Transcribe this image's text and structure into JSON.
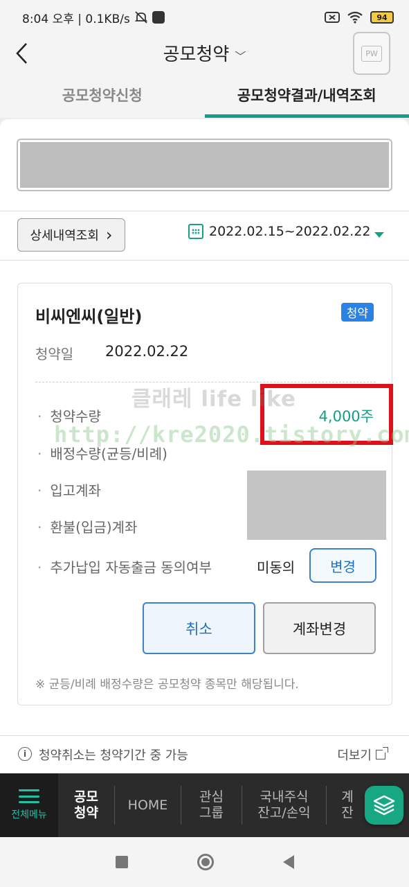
{
  "status_bar": {
    "time_speed": "8:04 오후 | 0.1KB/s",
    "battery": "94"
  },
  "header": {
    "title": "공모청약",
    "title_chevron": "chevron-down-icon",
    "pw_label": "PW"
  },
  "tabs": [
    {
      "label": "공모청약신청",
      "active": false
    },
    {
      "label": "공모청약결과/내역조회",
      "active": true
    }
  ],
  "filter": {
    "detail_button": "상세내역조회",
    "detail_chevron": "›",
    "date_range": "2022.02.15~2022.02.22"
  },
  "card": {
    "name": "비씨엔씨(일반)",
    "badge": "청약",
    "date_label": "청약일",
    "date_value": "2022.02.22",
    "rows": {
      "subscription_qty_label": "청약수량",
      "allocation_qty_label": "배정수량(균등/비례)",
      "deposit_account_label": "입고계좌",
      "refund_account_label": "환불(입금)계좌",
      "auto_withdraw_label": "추가납입 자동출금 동의여부"
    },
    "subscription_qty_value": "4,000주",
    "consent_value": "미동의",
    "change_button": "변경",
    "cancel_button": "취소",
    "account_change_button": "계좌변경",
    "note": "※ 균등/비례 배정수량은 공모청약 종목만 해당됩니다."
  },
  "watermark": {
    "line1": "클래레 life like",
    "line2": "http://kre2020.tistory.com"
  },
  "info": {
    "text": "청약취소는 청약기간 중 가능",
    "more": "더보기"
  },
  "bottom_nav": {
    "all_menu": "전체메뉴",
    "items": [
      {
        "label": "공모\n청약",
        "active": true
      },
      {
        "label": "HOME",
        "active": false
      },
      {
        "label": "관심\n그룹",
        "active": false
      },
      {
        "label": "국내주식\n잔고/손익",
        "active": false
      },
      {
        "label": "계\n잔",
        "active": false
      }
    ]
  },
  "colors": {
    "accent": "#139e87",
    "badge": "#2a82e4",
    "highlight": "#e0101a",
    "button_blue": "#1f6fc0"
  }
}
